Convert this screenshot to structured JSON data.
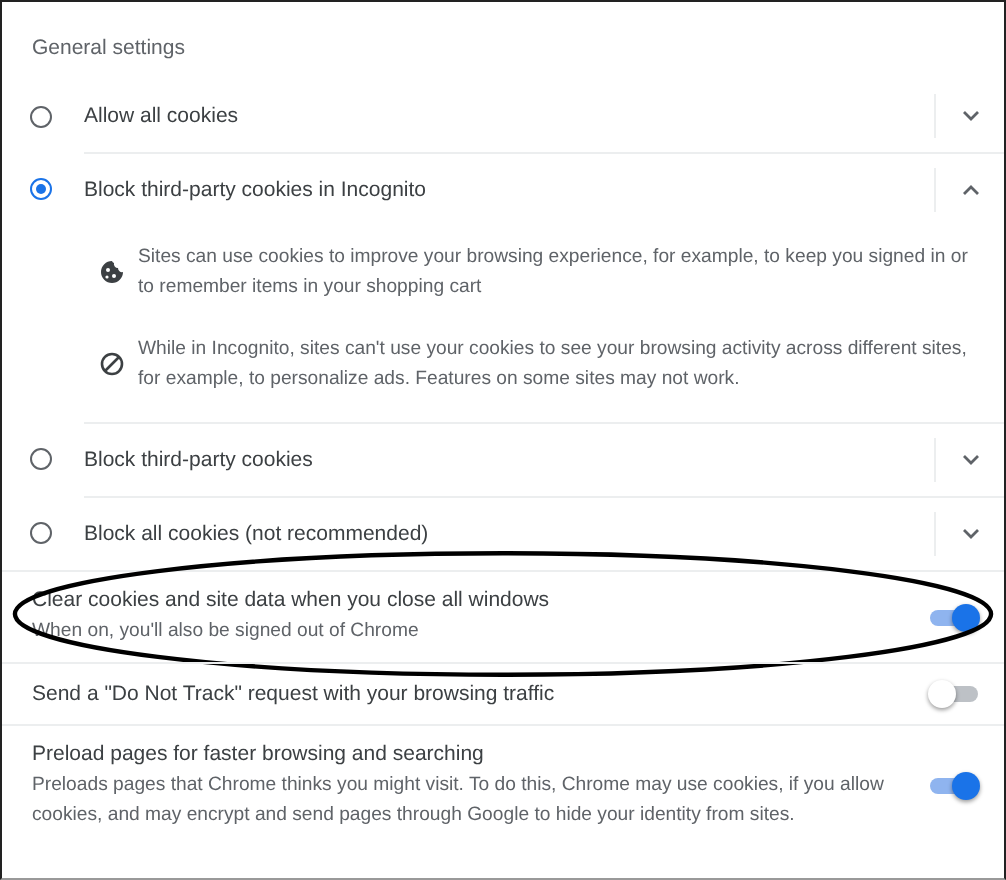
{
  "section_title": "General settings",
  "cookie_options": [
    {
      "label": "Allow all cookies",
      "selected": false,
      "expanded": false
    },
    {
      "label": "Block third-party cookies in Incognito",
      "selected": true,
      "expanded": true,
      "details": [
        {
          "kind": "cookie",
          "text": "Sites can use cookies to improve your browsing experience, for example, to keep you signed in or to remember items in your shopping cart"
        },
        {
          "kind": "blocked",
          "text": "While in Incognito, sites can't use your cookies to see your browsing activity across different sites, for example, to personalize ads. Features on some sites may not work."
        }
      ]
    },
    {
      "label": "Block third-party cookies",
      "selected": false,
      "expanded": false
    },
    {
      "label": "Block all cookies (not recommended)",
      "selected": false,
      "expanded": false
    }
  ],
  "toggles": [
    {
      "label": "Clear cookies and site data when you close all windows",
      "description": "When on, you'll also be signed out of Chrome",
      "on": true,
      "circled": true
    },
    {
      "label": "Send a \"Do Not Track\" request with your browsing traffic",
      "on": false,
      "circled": false
    },
    {
      "label": "Preload pages for faster browsing and searching",
      "description": "Preloads pages that Chrome thinks you might visit. To do this, Chrome may use cookies, if you allow cookies, and may encrypt and send pages through Google to hide your identity from sites.",
      "on": true,
      "circled": false
    }
  ]
}
